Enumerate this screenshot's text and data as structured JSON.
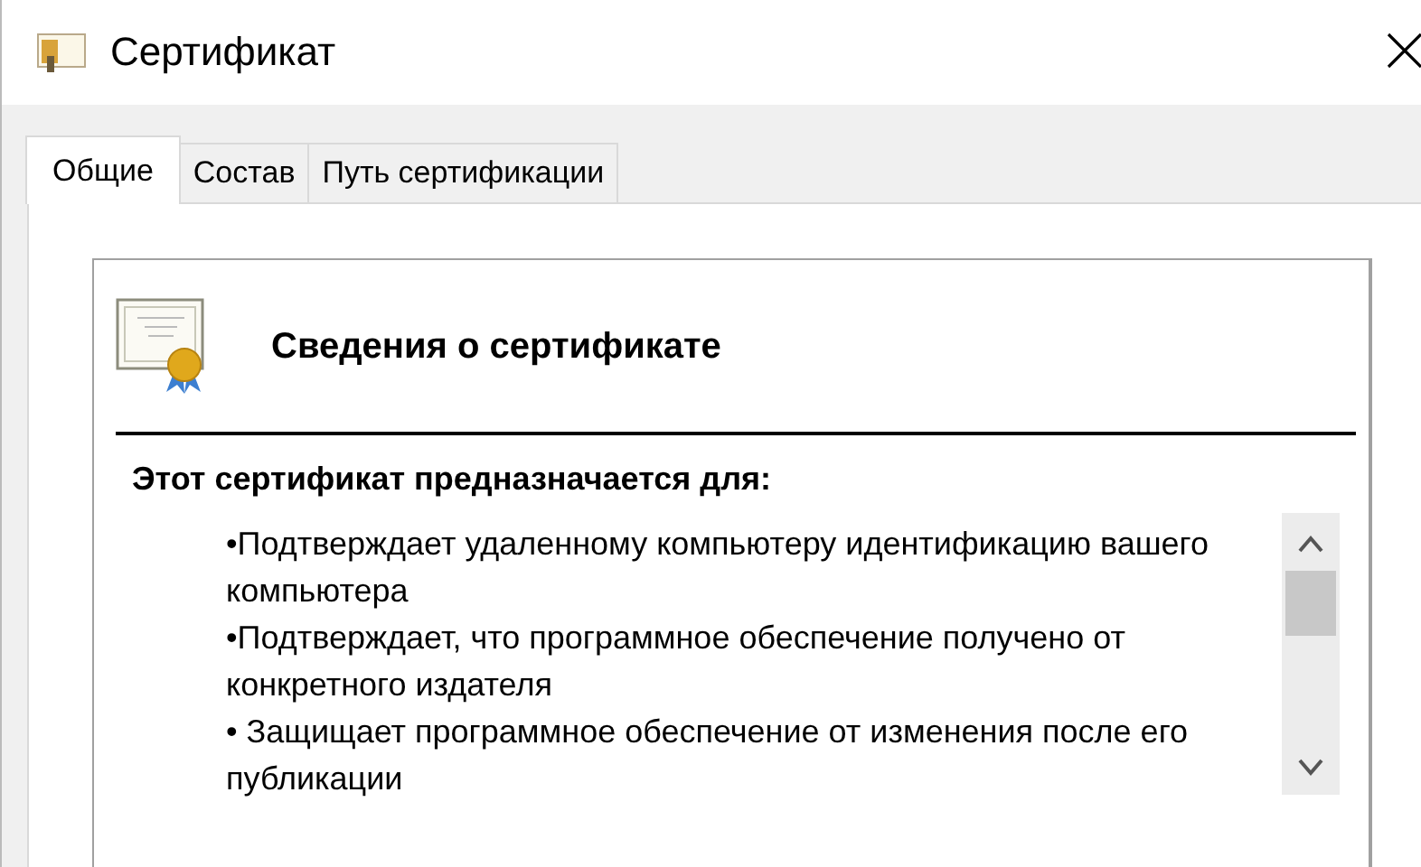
{
  "window": {
    "title": "Сертификат"
  },
  "tabs": [
    {
      "label": "Общие",
      "selected": true
    },
    {
      "label": "Состав",
      "selected": false
    },
    {
      "label": "Путь сертификации",
      "selected": false
    }
  ],
  "info": {
    "heading": "Сведения о сертификате",
    "purpose_title": "Этот сертификат предназначается для:",
    "purposes": [
      "•Подтверждает удаленному компьютеру идентификацию вашего компьютера",
      "•Подтверждает, что программное обеспечение получено от конкретного издателя",
      "• Защищает программное обеспечение от  изменения после его публикации"
    ]
  }
}
